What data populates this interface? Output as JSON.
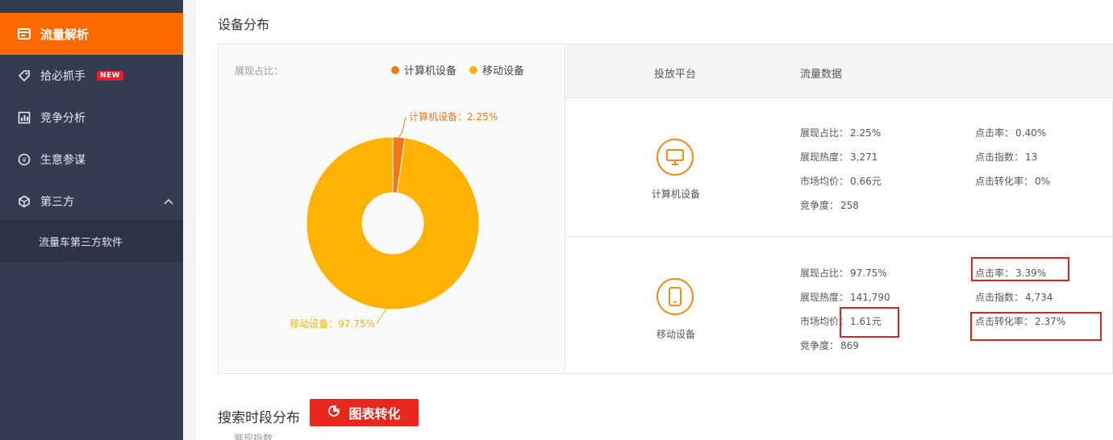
{
  "sidebar": {
    "items": [
      {
        "label": "流量解析",
        "icon": "card-icon"
      },
      {
        "label": "拾必抓手",
        "badge": "NEW",
        "icon": "tag-icon"
      },
      {
        "label": "竞争分析",
        "icon": "chart-icon"
      },
      {
        "label": "生意参谋",
        "icon": "coin-icon"
      },
      {
        "label": "第三方",
        "icon": "cube-icon"
      }
    ],
    "sub_item": "流量车第三方软件"
  },
  "device_section": {
    "title": "设备分布",
    "pie_caption": "展现占比：",
    "legend": [
      {
        "label": "计算机设备",
        "color": "#f07a1a"
      },
      {
        "label": "移动设备",
        "color": "#ffb300"
      }
    ],
    "table_headers": [
      "投放平台",
      "流量数据"
    ],
    "devices": [
      {
        "name": "计算机设备",
        "icon": "monitor-icon",
        "stats_left": [
          {
            "label": "展现占比",
            "value": "2.25%"
          },
          {
            "label": "展现热度",
            "value": "3,271"
          },
          {
            "label": "市场均价",
            "value": "0.66元"
          },
          {
            "label": "竞争度",
            "value": "258"
          }
        ],
        "stats_right": [
          {
            "label": "点击率",
            "value": "0.40%"
          },
          {
            "label": "点击指数",
            "value": "13"
          },
          {
            "label": "点击转化率",
            "value": "0%"
          }
        ]
      },
      {
        "name": "移动设备",
        "icon": "phone-icon",
        "stats_left": [
          {
            "label": "展现占比",
            "value": "97.75%"
          },
          {
            "label": "展现热度",
            "value": "141,790"
          },
          {
            "label": "市场均价",
            "value": "1.61元"
          },
          {
            "label": "竞争度",
            "value": "869"
          }
        ],
        "stats_right": [
          {
            "label": "点击率",
            "value": "3.39%"
          },
          {
            "label": "点击指数",
            "value": "4,734"
          },
          {
            "label": "点击转化率",
            "value": "2.37%"
          }
        ]
      }
    ]
  },
  "chart_data": {
    "type": "pie",
    "title": "",
    "categories": [
      "计算机设备",
      "移动设备"
    ],
    "values": [
      2.25,
      97.75
    ],
    "labels": [
      "计算机设备：2.25%",
      "移动设备：97.75%"
    ],
    "colors": [
      "#f07a1a",
      "#ffb300"
    ],
    "donut": true,
    "legend_position": "top-right"
  },
  "search_section": {
    "title": "搜索时段分布",
    "convert_button": "图表转化",
    "partial_text": "展现指数"
  },
  "colors": {
    "accent": "#ff6a00",
    "sidebar_bg": "#343c52",
    "highlight_box": "#d9261c"
  }
}
